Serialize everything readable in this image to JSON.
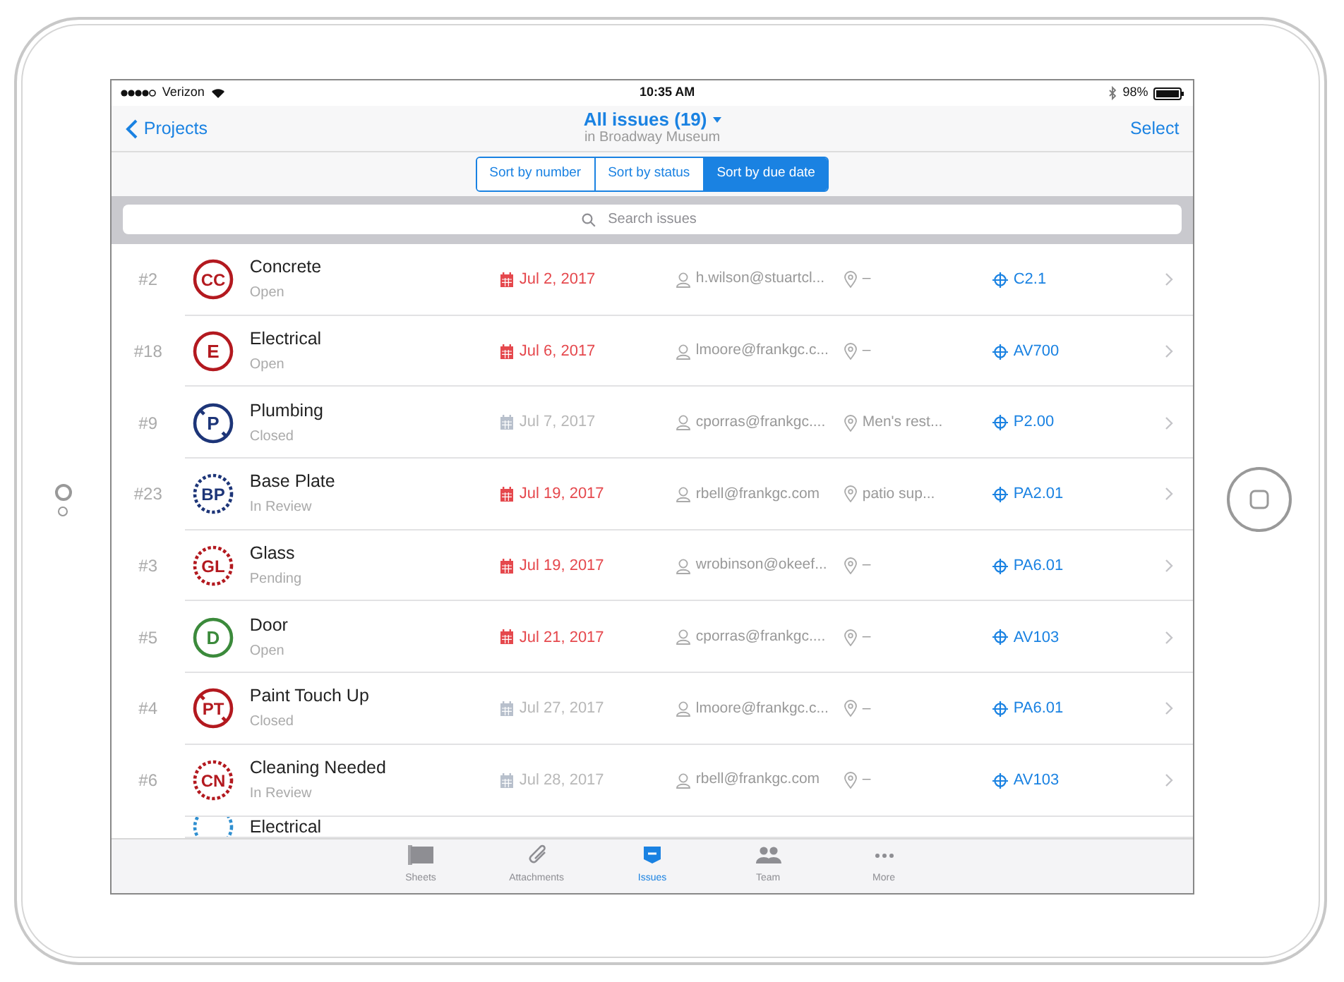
{
  "status_bar": {
    "carrier": "Verizon",
    "time": "10:35 AM",
    "battery": "98%"
  },
  "nav": {
    "back": "Projects",
    "title": "All issues (19)",
    "subtitle": "in Broadway Museum",
    "action": "Select"
  },
  "sort_options": [
    {
      "label": "Sort by number",
      "selected": false
    },
    {
      "label": "Sort by status",
      "selected": false
    },
    {
      "label": "Sort by due date",
      "selected": true
    }
  ],
  "search": {
    "placeholder": "Search issues"
  },
  "issues": [
    {
      "number": "#2",
      "badge": "CC",
      "color": "#b3191f",
      "kind": "solid",
      "struck": false,
      "title": "Concrete",
      "status": "Open",
      "due": "Jul 2, 2017",
      "overdue": true,
      "assignee": "h.wilson@stuartcl...",
      "location": "–",
      "sheet": "C2.1"
    },
    {
      "number": "#18",
      "badge": "E",
      "color": "#b3191f",
      "kind": "solid",
      "struck": false,
      "title": "Electrical",
      "status": "Open",
      "due": "Jul 6, 2017",
      "overdue": true,
      "assignee": "lmoore@frankgc.c...",
      "location": "–",
      "sheet": "AV700"
    },
    {
      "number": "#9",
      "badge": "P",
      "color": "#1d3578",
      "kind": "solid",
      "struck": true,
      "title": "Plumbing",
      "status": "Closed",
      "due": "Jul 7, 2017",
      "overdue": false,
      "assignee": "cporras@frankgc....",
      "location": "Men's rest...",
      "sheet": "P2.00"
    },
    {
      "number": "#23",
      "badge": "BP",
      "color": "#1d3578",
      "kind": "dashed",
      "struck": false,
      "title": "Base Plate",
      "status": "In Review",
      "due": "Jul 19, 2017",
      "overdue": true,
      "assignee": "rbell@frankgc.com",
      "location": "patio  sup...",
      "sheet": "PA2.01"
    },
    {
      "number": "#3",
      "badge": "GL",
      "color": "#b3191f",
      "kind": "dashed",
      "struck": false,
      "title": "Glass",
      "status": "Pending",
      "due": "Jul 19, 2017",
      "overdue": true,
      "assignee": "wrobinson@okeef...",
      "location": "–",
      "sheet": "PA6.01"
    },
    {
      "number": "#5",
      "badge": "D",
      "color": "#3b8a3b",
      "kind": "solid",
      "struck": false,
      "title": "Door",
      "status": "Open",
      "due": "Jul 21, 2017",
      "overdue": true,
      "assignee": "cporras@frankgc....",
      "location": "–",
      "sheet": "AV103"
    },
    {
      "number": "#4",
      "badge": "PT",
      "color": "#b3191f",
      "kind": "solid",
      "struck": true,
      "title": "Paint Touch Up",
      "status": "Closed",
      "due": "Jul 27, 2017",
      "overdue": false,
      "assignee": "lmoore@frankgc.c...",
      "location": "–",
      "sheet": "PA6.01"
    },
    {
      "number": "#6",
      "badge": "CN",
      "color": "#b3191f",
      "kind": "dashed",
      "struck": false,
      "title": "Cleaning Needed",
      "status": "In Review",
      "due": "Jul 28, 2017",
      "overdue": false,
      "assignee": "rbell@frankgc.com",
      "location": "–",
      "sheet": "AV103"
    },
    {
      "color": "#2f8fd0",
      "kind": "dashed",
      "title": "Electrical"
    }
  ],
  "tab_bar": [
    {
      "label": "Sheets",
      "selected": false
    },
    {
      "label": "Attachments",
      "selected": false
    },
    {
      "label": "Issues",
      "selected": true
    },
    {
      "label": "Team",
      "selected": false
    },
    {
      "label": "More",
      "selected": false
    }
  ]
}
